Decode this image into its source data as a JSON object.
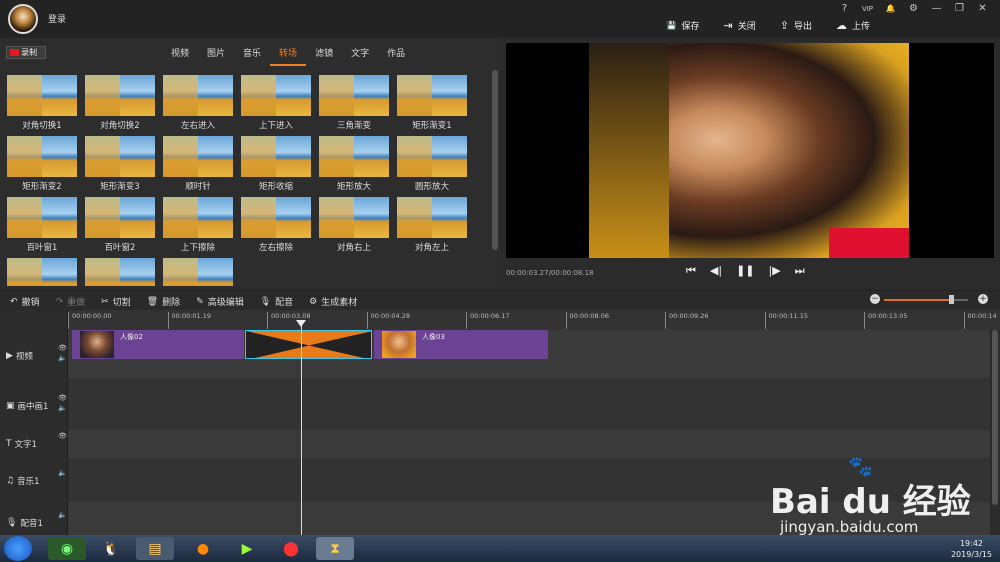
{
  "titlebar": {
    "login_label": "登录",
    "window_buttons": [
      "?",
      "VIP",
      "🔔",
      "⚙",
      "—",
      "❐",
      "✕"
    ]
  },
  "actions": [
    {
      "icon": "save-icon",
      "glyph": "💾",
      "label": "保存"
    },
    {
      "icon": "close-doc-icon",
      "glyph": "⇥",
      "label": "关闭"
    },
    {
      "icon": "export-icon",
      "glyph": "⇪",
      "label": "导出"
    },
    {
      "icon": "upload-icon",
      "glyph": "☁",
      "label": "上传"
    }
  ],
  "record": {
    "label": "录制"
  },
  "category_tabs": [
    {
      "label": "视频",
      "active": false
    },
    {
      "label": "图片",
      "active": false
    },
    {
      "label": "音乐",
      "active": false
    },
    {
      "label": "转场",
      "active": true
    },
    {
      "label": "滤镜",
      "active": false
    },
    {
      "label": "文字",
      "active": false
    },
    {
      "label": "作品",
      "active": false
    }
  ],
  "transitions": [
    "对角切换1",
    "对角切换2",
    "左右进入",
    "上下进入",
    "三角渐变",
    "矩形渐变1",
    "矩形渐变2",
    "矩形渐变3",
    "顺时针",
    "矩形收缩",
    "矩形放大",
    "圆形放大",
    "百叶窗1",
    "百叶窗2",
    "上下擦除",
    "左右擦除",
    "对角右上",
    "对角左上",
    "",
    "",
    ""
  ],
  "preview": {
    "timecode": "00:00:03.27/00:00:08.18",
    "controls": [
      "⏮",
      "◀|",
      "❚❚",
      "|▶",
      "⏭"
    ]
  },
  "toolbar": [
    {
      "icon": "undo-icon",
      "glyph": "↶",
      "label": "撤销",
      "enabled": true
    },
    {
      "icon": "redo-icon",
      "glyph": "↷",
      "label": "重做",
      "enabled": false
    },
    {
      "icon": "cut-icon",
      "glyph": "✂",
      "label": "切割",
      "enabled": true
    },
    {
      "icon": "delete-icon",
      "glyph": "🗑",
      "label": "删除",
      "enabled": true
    },
    {
      "icon": "edit-icon",
      "glyph": "✎",
      "label": "高级编辑",
      "enabled": true
    },
    {
      "icon": "mic-icon",
      "glyph": "🎙",
      "label": "配音",
      "enabled": true
    },
    {
      "icon": "generate-icon",
      "glyph": "⚙",
      "label": "生成素材",
      "enabled": true
    }
  ],
  "zoom": {
    "level": 0.8
  },
  "ruler": [
    "00:00:00.00",
    "00:00:01.19",
    "00:00:03.08",
    "00:00:04.28",
    "00:00:06.17",
    "00:00:08.06",
    "00:00:09.26",
    "00:00:11.15",
    "00:00:13.05",
    "00:00:14"
  ],
  "tracks": [
    {
      "label": "视频",
      "glyph": "▶"
    },
    {
      "label": "画中画1",
      "glyph": "▣"
    },
    {
      "label": "文字1",
      "glyph": "T"
    },
    {
      "label": "音乐1",
      "glyph": "♫"
    },
    {
      "label": "配音1",
      "glyph": "🎙"
    }
  ],
  "clips": [
    {
      "name": "人像02"
    },
    {
      "name": "人像03"
    }
  ],
  "taskbar": {
    "time": "19:42",
    "date": "2019/3/15"
  },
  "watermark": {
    "brand": "Bai du 经验",
    "url": "jingyan.baidu.com"
  }
}
